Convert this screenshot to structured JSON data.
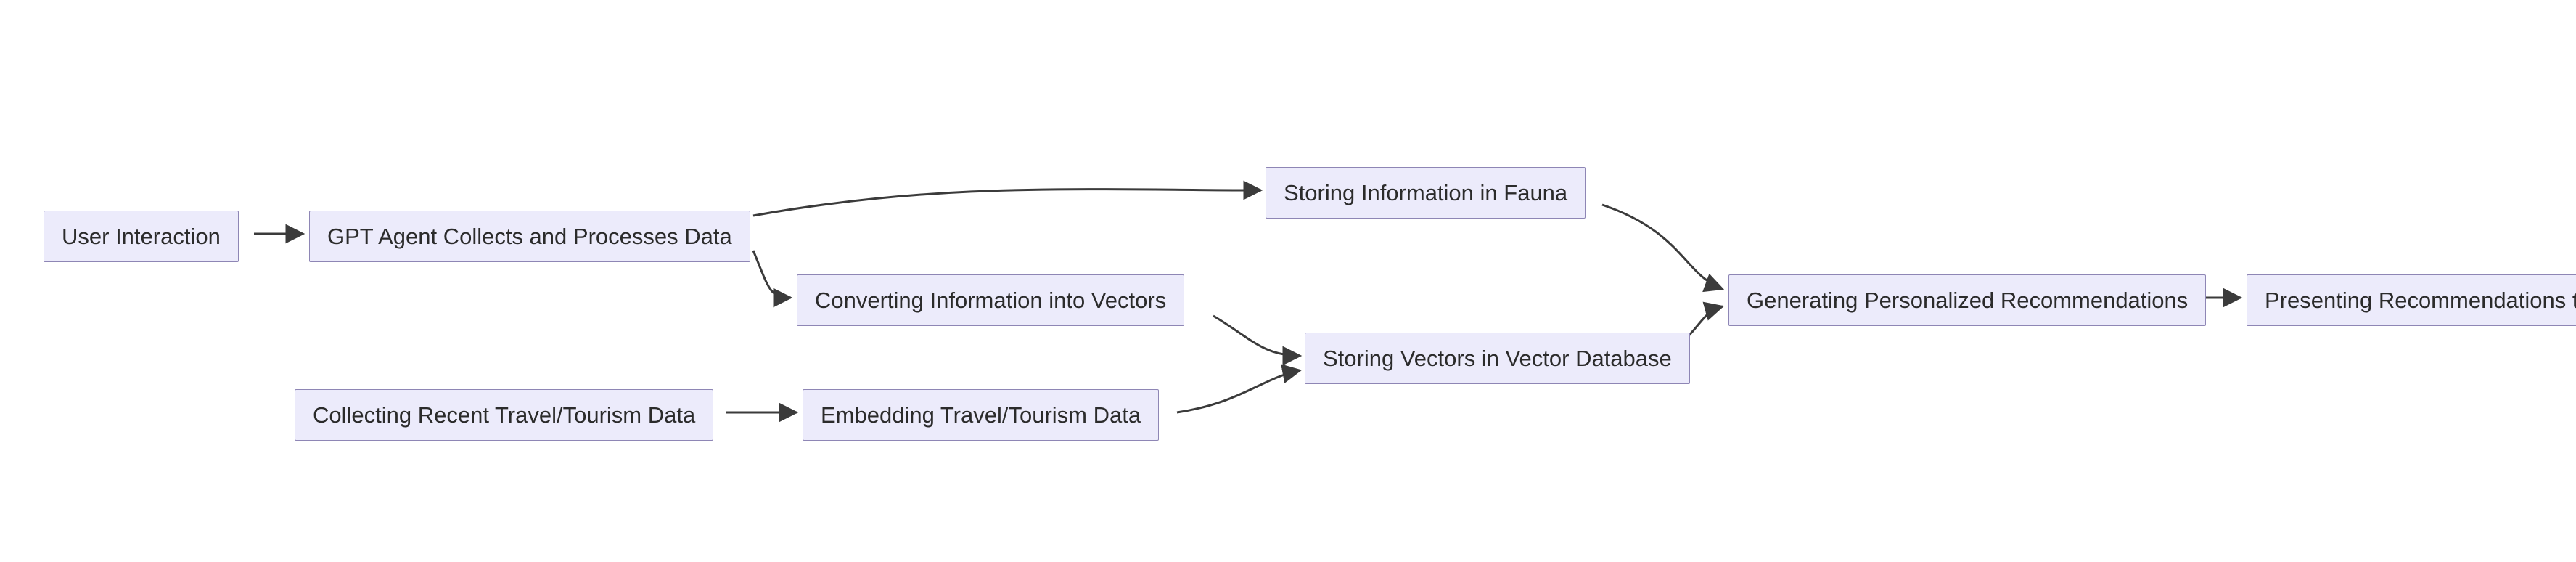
{
  "chart_data": {
    "type": "flowchart",
    "nodes": [
      {
        "id": "A",
        "label": "User Interaction"
      },
      {
        "id": "B",
        "label": "GPT Agent Collects and Processes Data"
      },
      {
        "id": "C",
        "label": "Storing Information in Fauna"
      },
      {
        "id": "D",
        "label": "Converting Information into Vectors"
      },
      {
        "id": "E",
        "label": "Storing Vectors in Vector Database"
      },
      {
        "id": "F",
        "label": "Collecting Recent Travel/Tourism Data"
      },
      {
        "id": "G",
        "label": "Embedding Travel/Tourism Data"
      },
      {
        "id": "H",
        "label": "Generating Personalized Recommendations"
      },
      {
        "id": "I",
        "label": "Presenting Recommendations to User"
      }
    ],
    "edges": [
      {
        "from": "A",
        "to": "B"
      },
      {
        "from": "B",
        "to": "C"
      },
      {
        "from": "B",
        "to": "D"
      },
      {
        "from": "D",
        "to": "E"
      },
      {
        "from": "F",
        "to": "G"
      },
      {
        "from": "G",
        "to": "E"
      },
      {
        "from": "C",
        "to": "H"
      },
      {
        "from": "E",
        "to": "H"
      },
      {
        "from": "H",
        "to": "I"
      }
    ]
  },
  "nodes": {
    "A": {
      "label": "User Interaction"
    },
    "B": {
      "label": "GPT Agent Collects and Processes Data"
    },
    "C": {
      "label": "Storing Information in Fauna"
    },
    "D": {
      "label": "Converting Information into Vectors"
    },
    "E": {
      "label": "Storing Vectors in Vector Database"
    },
    "F": {
      "label": "Collecting Recent Travel/Tourism Data"
    },
    "G": {
      "label": "Embedding Travel/Tourism Data"
    },
    "H": {
      "label": "Generating Personalized Recommendations"
    },
    "I": {
      "label": "Presenting Recommendations to User"
    }
  },
  "colors": {
    "node_fill": "#ecebfb",
    "node_stroke": "#8e86b5",
    "edge_stroke": "#3b3b3b"
  }
}
